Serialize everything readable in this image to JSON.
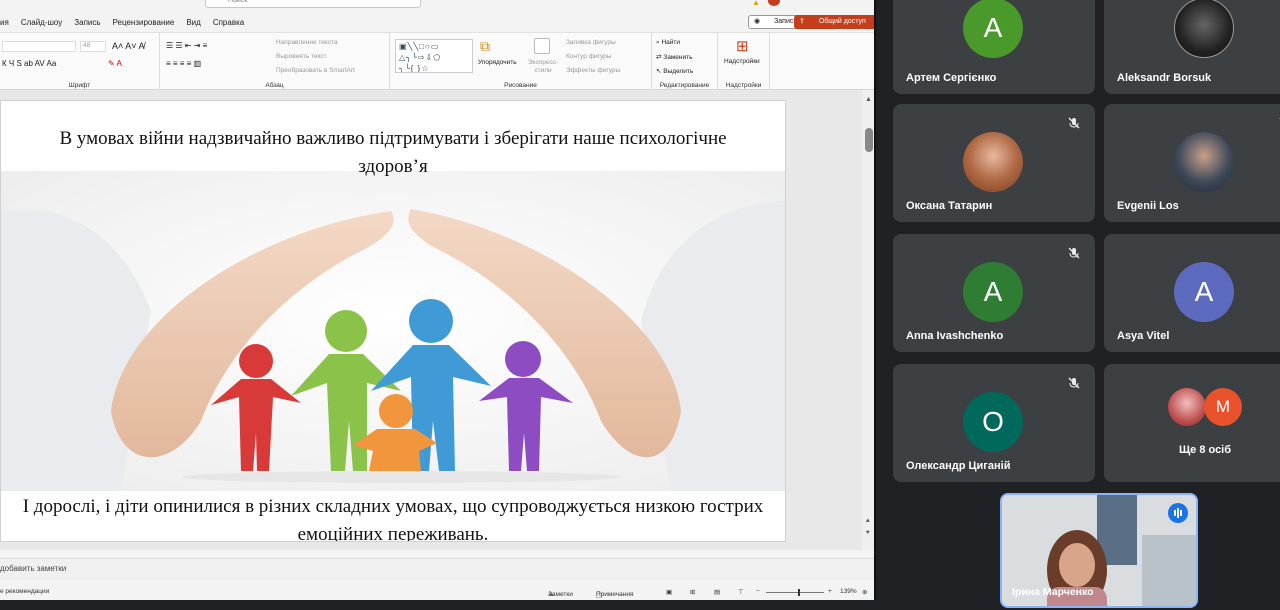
{
  "powerpoint": {
    "search_placeholder": "Поиск",
    "tabs": [
      "ия",
      "Слайд-шоу",
      "Запись",
      "Рецензирование",
      "Вид",
      "Справка"
    ],
    "record_button": "Запись",
    "share_button": "Общий доступ",
    "ribbon": {
      "font_group": "Шрифт",
      "paragraph_group": "Абзац",
      "drawing_group": "Рисование",
      "editing_group": "Редактирование",
      "addins_group": "Надстройки",
      "text_direction": "Направление текста",
      "align_text": "Выровнять текст",
      "convert_smartart": "Преобразовать в SmartArt",
      "arrange": "Упорядочить",
      "quick_styles": "Экспресс-стили",
      "shape_fill": "Заливка фигуры",
      "shape_outline": "Контур фигуры",
      "shape_effects": "Эффекты фигуры",
      "find": "Найти",
      "replace": "Заменить",
      "select": "Выделить",
      "addins": "Надстройки",
      "font_size": "48"
    },
    "slide": {
      "top_text": "В умовах війни надзвичайно важливо підтримувати і зберігати наше психологічне здоров’я",
      "bottom_text": "І дорослі, і діти опинилися в різних складних умовах, що супроводжується низкою гострих емоційних переживань."
    },
    "notes_placeholder": "добавить заметки",
    "status": {
      "left": "е рекомендации",
      "notes": "Заметки",
      "comments": "Примечания",
      "zoom": "139%"
    }
  },
  "meet": {
    "participants": [
      {
        "name": "Артем Сергієнко",
        "initial": "A",
        "color": "#4a9a2b",
        "muted": false
      },
      {
        "name": "Aleksandr Borsuk",
        "initial": "",
        "color": "#2b2b2b",
        "muted": false
      },
      {
        "name": "Оксана Татарин",
        "initial": "",
        "color": "#a55a36",
        "muted": true
      },
      {
        "name": "Evgenii Los",
        "initial": "",
        "color": "#3a4452",
        "muted": true
      },
      {
        "name": "Anna Ivashchenko",
        "initial": "A",
        "color": "#2e7d32",
        "muted": true
      },
      {
        "name": "Asya Vitel",
        "initial": "A",
        "color": "#5c6bc0",
        "muted": false
      },
      {
        "name": "Олександр Циганій",
        "initial": "O",
        "color": "#00695c",
        "muted": true
      }
    ],
    "more": {
      "label": "Ще 8 осіб",
      "initial": "M",
      "color": "#e8532b"
    },
    "self": {
      "name": "Ірина Марченко"
    }
  }
}
